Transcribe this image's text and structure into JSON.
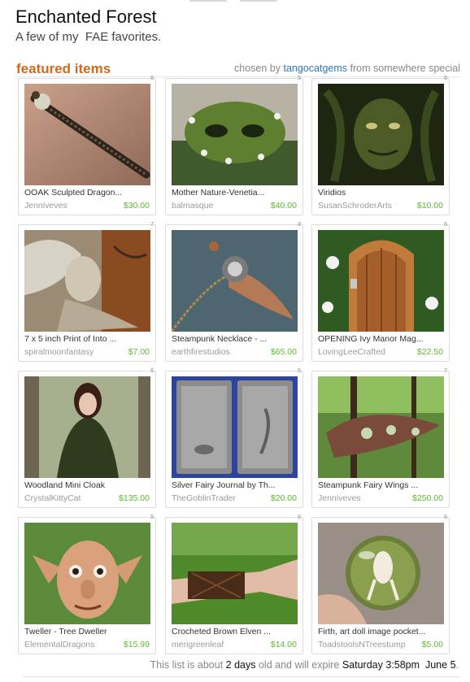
{
  "treasury": {
    "title": "Enchanted Forest",
    "subtitle": "A few of my  FAE favorites."
  },
  "section": {
    "heading": "featured items",
    "chosen_by_label": "chosen by",
    "curator": "tangocatgems",
    "from_label": "from",
    "location": "somewhere special"
  },
  "items": [
    {
      "num": "6",
      "title": "OOAK Sculpted Dragon...",
      "seller": "Jenniveves",
      "price": "$30.00",
      "image": "sculpted-dragon-wand"
    },
    {
      "num": "5",
      "title": "Mother Nature-Venetia...",
      "seller": "balmasque",
      "price": "$40.00",
      "image": "green-leaf-mask"
    },
    {
      "num": "6",
      "title": "Viridios",
      "seller": "SusanSchroderArts",
      "price": "$10.00",
      "image": "green-man-face"
    },
    {
      "num": "7",
      "title": "7 x 5 inch Print of Into ...",
      "seller": "spiralmoonfantasy",
      "price": "$7.00",
      "image": "fairy-print"
    },
    {
      "num": "8",
      "title": "Steampunk Necklace - ...",
      "seller": "earthfirestudios",
      "price": "$65.00",
      "image": "steampunk-wing-necklace"
    },
    {
      "num": "6",
      "title": "OPENING Ivy Manor Mag...",
      "seller": "LovingLeeCrafted",
      "price": "$22.50",
      "image": "fairy-door"
    },
    {
      "num": "6",
      "title": "Woodland Mini Cloak",
      "seller": "CrystalKittyCat",
      "price": "$135.00",
      "image": "woman-in-cloak"
    },
    {
      "num": "5",
      "title": "Silver Fairy Journal by Th...",
      "seller": "TheGoblinTrader",
      "price": "$20.00",
      "image": "silver-fairy-journal"
    },
    {
      "num": "7",
      "title": "Steampunk Fairy Wings ...",
      "seller": "Jenniveves",
      "price": "$250.00",
      "image": "steampunk-fairy-wings"
    },
    {
      "num": "5",
      "title": "Tweller - Tree Dweller",
      "seller": "ElementalDragons",
      "price": "$15.99",
      "image": "elf-sculpture"
    },
    {
      "num": "6",
      "title": "Crocheted Brown Elven ...",
      "seller": "merigreenleaf",
      "price": "$14.00",
      "image": "crocheted-armband"
    },
    {
      "num": "6",
      "title": "Firth, art doll image pocket...",
      "seller": "ToadstoolsNTreestump",
      "price": "$5.00",
      "image": "glass-marble-fairy"
    }
  ],
  "footer": {
    "prefix": "This list is about",
    "age": "2 days",
    "middle": "old and will expire",
    "expire_time": "Saturday 3:58pm",
    "expire_date": "June 5",
    "suffix": "."
  },
  "colors": {
    "heading": "#d06a1a",
    "curator_link": "#2a7bb5",
    "price": "#5dba2e",
    "muted": "#9b9b9b"
  }
}
